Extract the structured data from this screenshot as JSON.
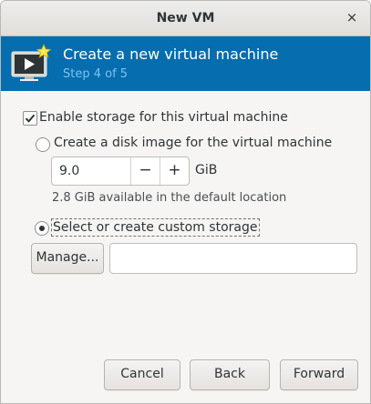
{
  "window": {
    "title": "New VM",
    "close_glyph": "×"
  },
  "header": {
    "icon": "monitor-new-icon",
    "title": "Create a new virtual machine",
    "step": "Step 4 of 5",
    "background": "#066dae",
    "step_color": "#7cc3ec"
  },
  "storage": {
    "enable_label": "Enable storage for this virtual machine",
    "enable_checked": true,
    "disk_image_label": "Create a disk image for the virtual machine",
    "disk_image_selected": false,
    "disk_size": "9.0",
    "decrement_glyph": "−",
    "increment_glyph": "+",
    "unit": "GiB",
    "available_text": "2.8 GiB available in the default location",
    "custom_label": "Select or create custom storage",
    "custom_selected": true,
    "manage_label": "Manage...",
    "custom_path_value": ""
  },
  "footer": {
    "cancel_label": "Cancel",
    "back_label": "Back",
    "forward_label": "Forward"
  }
}
